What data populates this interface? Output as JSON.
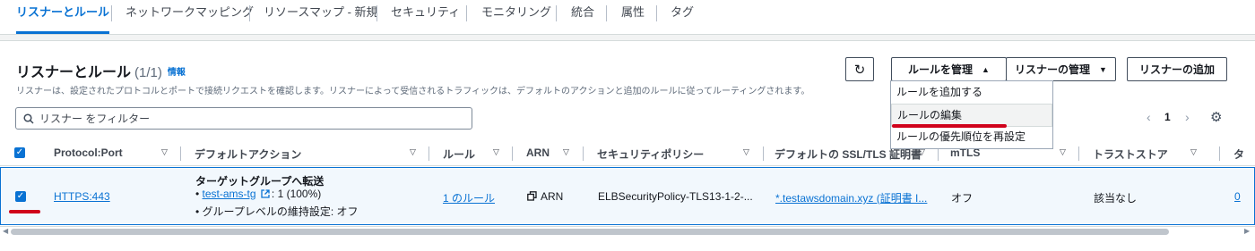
{
  "tabs": [
    "リスナーとルール",
    "ネットワークマッピング",
    "リソースマップ - 新規",
    "セキュリティ",
    "モニタリング",
    "統合",
    "属性",
    "タグ"
  ],
  "panel": {
    "title": "リスナーとルール",
    "count": "(1/1)",
    "info": "情報",
    "description": "リスナーは、設定されたプロトコルとポートで接続リクエストを確認します。リスナーによって受信されるトラフィックは、デフォルトのアクションと追加のルールに従ってルーティングされます。"
  },
  "toolbar": {
    "refresh_icon": "↻",
    "manage_rules": "ルールを管理",
    "manage_rules_caret": "▲",
    "manage_listener": "リスナーの管理",
    "manage_listener_caret": "▼",
    "add_listener": "リスナーの追加"
  },
  "dropdown": {
    "items": [
      "ルールを追加する",
      "ルールの編集",
      "ルールの優先順位を再設定"
    ]
  },
  "filter": {
    "placeholder": "リスナー をフィルター",
    "icon": "search-icon"
  },
  "pagination": {
    "prev": "‹",
    "page": "1",
    "next": "›",
    "settings_icon": "⚙"
  },
  "table": {
    "headers": [
      "Protocol:Port",
      "デフォルトアクション",
      "ルール",
      "ARN",
      "セキュリティポリシー",
      "デフォルトの SSL/TLS 証明書",
      "mTLS",
      "トラストストア",
      "タ"
    ],
    "row": {
      "protocol_port": "HTTPS:443",
      "action_title": "ターゲットグループへ転送",
      "target_group": "test-ams-tg",
      "target_weight": ": 1 (100%)",
      "stickiness": "グループレベルの維持設定: オフ",
      "rules": "1 のルール",
      "arn": "ARN",
      "security_policy": "ELBSecurityPolicy-TLS13-1-2-...",
      "certificate": "*.testawsdomain.xyz (証明書 I...",
      "mtls": "オフ",
      "truststore": "該当なし",
      "tags": "0"
    }
  },
  "colors": {
    "accent": "#0972d3",
    "annotation": "#d0021b"
  }
}
